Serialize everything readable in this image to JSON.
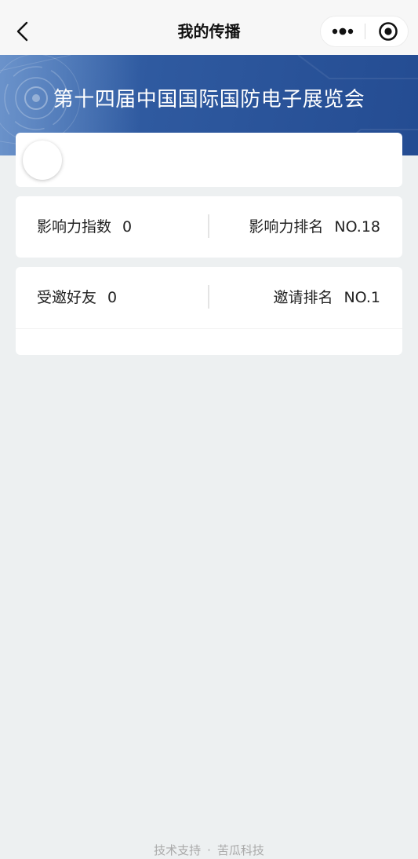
{
  "navbar": {
    "title": "我的传播",
    "back_icon": "chevron-left-icon",
    "more_icon": "more-dots-icon",
    "close_icon": "target-circle-icon"
  },
  "banner": {
    "title": "第十四届中国国际国防电子展览会",
    "background_color": "#2f5aa0"
  },
  "influence": {
    "index_label": "影响力指数",
    "index_value": "0",
    "rank_label": "影响力排名",
    "rank_value": "NO.18"
  },
  "invite": {
    "friends_label": "受邀好友",
    "friends_value": "0",
    "rank_label": "邀请排名",
    "rank_value": "NO.1"
  },
  "footer": {
    "left": "技术支持",
    "separator": "·",
    "right": "苦瓜科技"
  }
}
